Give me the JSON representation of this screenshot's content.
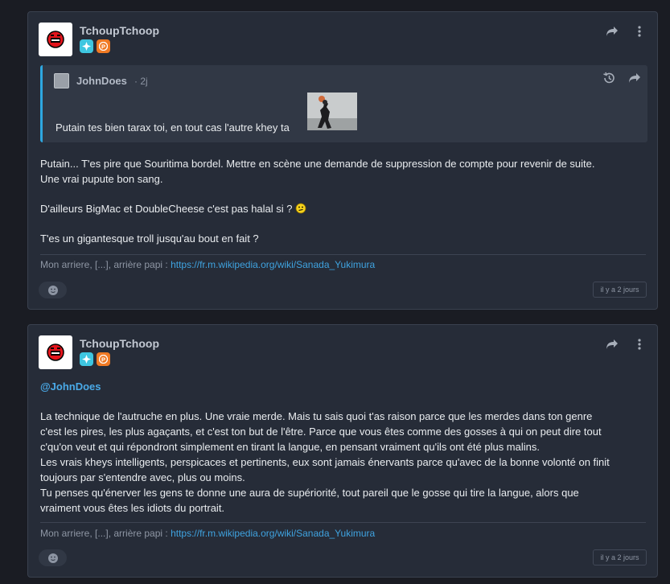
{
  "posts": [
    {
      "author": "TchoupTchoop",
      "badge_blue_icon": "sparkle-badge-icon",
      "badge_orange_icon": "p-badge-icon",
      "quote": {
        "author": "JohnDoes",
        "time": "· 2j",
        "text": "Putain tes bien tarax toi, en tout cas l'autre khey ta"
      },
      "body": [
        "Putain... T'es pire que Souritima bordel. Mettre en scène une demande de suppression de compte pour revenir de suite.",
        "Une vrai pupute bon sang.",
        "D'ailleurs BigMac et DoubleCheese c'est pas halal si ?",
        "T'es un gigantesque troll jusqu'au bout en fait ?"
      ],
      "signature_prefix": "Mon arriere, [...], arrière papi :",
      "signature_link": "https://fr.m.wikipedia.org/wiki/Sanada_Yukimura",
      "time": "il y a 2 jours"
    },
    {
      "author": "TchoupTchoop",
      "mention": "@JohnDoes",
      "body": [
        "La technique de l'autruche en plus. Une vraie merde. Mais tu sais quoi t'as raison parce que les merdes dans ton genre",
        "c'est les pires, les plus agaçants, et c'est ton but de l'être. Parce que vous êtes comme des gosses à qui on peut dire tout",
        "c'qu'on veut et qui répondront simplement en tirant la langue, en pensant vraiment qu'ils ont été plus malins.",
        "Les vrais kheys intelligents, perspicaces et pertinents, eux sont jamais énervants parce qu'avec de la bonne volonté on finit",
        "toujours par s'entendre avec, plus ou moins.",
        "Tu penses qu'énerver les gens te donne une aura de supériorité, tout pareil que le gosse qui tire la langue, alors que",
        "vraiment vous êtes les idiots du portrait."
      ],
      "signature_prefix": "Mon arriere, [...], arrière papi :",
      "signature_link": "https://fr.m.wikipedia.org/wiki/Sanada_Yukimura",
      "time": "il y a 2 jours"
    }
  ],
  "colors": {
    "background": "#1a1c23",
    "card": "#262c38",
    "link": "#3fa3e0",
    "quote_bar": "#2ea7e0"
  }
}
